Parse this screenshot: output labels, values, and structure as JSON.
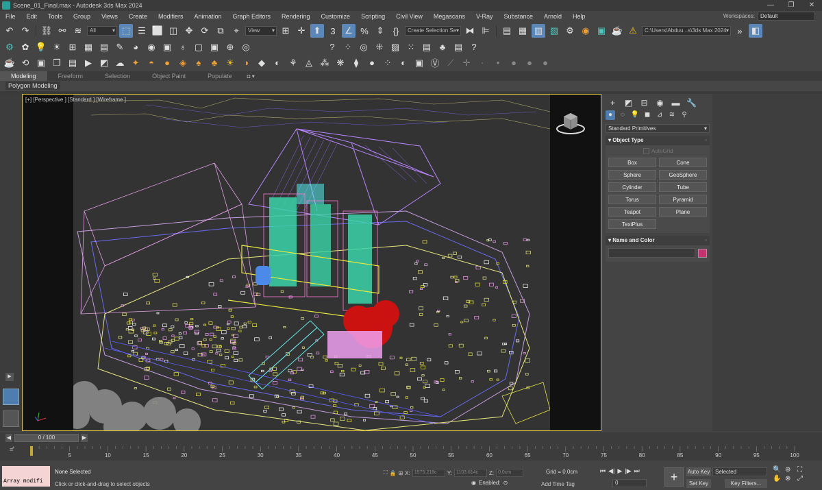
{
  "title": "Scene_01_Final.max - Autodesk 3ds Max 2024",
  "window_controls": [
    "—",
    "❐",
    "✕"
  ],
  "menu": [
    "File",
    "Edit",
    "Tools",
    "Group",
    "Views",
    "Create",
    "Modifiers",
    "Animation",
    "Graph Editors",
    "Rendering",
    "Customize",
    "Scripting",
    "Civil View",
    "Megascans",
    "V-Ray",
    "Substance",
    "Arnold",
    "Help"
  ],
  "workspaces": {
    "label": "Workspaces:",
    "value": "Default"
  },
  "toolbar": {
    "selection_filter": "All",
    "ref_coord": "View",
    "selection_set": "Create Selection Se",
    "project_path": "C:\\Users\\Abduu...s\\3ds Max 2024"
  },
  "ribbon": {
    "tabs": [
      "Modeling",
      "Freeform",
      "Selection",
      "Object Paint",
      "Populate"
    ],
    "active": "Modeling",
    "pin": "◘ ▾",
    "sub_label": "Polygon Modeling"
  },
  "viewport": {
    "label": "[+] [Perspective ] [Standard ] [Wireframe ]"
  },
  "command_panel": {
    "category": "Standard Primitives",
    "object_type_title": "Object Type",
    "autogrid": "AutoGrid",
    "objects": [
      "Box",
      "Cone",
      "Sphere",
      "GeoSphere",
      "Cylinder",
      "Tube",
      "Torus",
      "Pyramid",
      "Teapot",
      "Plane",
      "TextPlus"
    ],
    "name_color_title": "Name and Color",
    "object_color": "#c2336f"
  },
  "timeline": {
    "frame_display": "0 / 100",
    "ticks": [
      0,
      5,
      10,
      15,
      20,
      25,
      30,
      35,
      40,
      45,
      50,
      55,
      60,
      65,
      70,
      75,
      80,
      85,
      90,
      95,
      100
    ]
  },
  "status": {
    "listener_text": "Array modifi",
    "selection": "None Selected",
    "prompt": "Click or click-and-drag to select objects",
    "x_label": "X:",
    "x_value": "1575.218c",
    "y_label": "Y:",
    "y_value": "1103.614c",
    "z_label": "Z:",
    "z_value": "0.0cm",
    "grid": "Grid = 0.0cm",
    "enabled": "Enabled:",
    "add_time_tag": "Add Time Tag",
    "current_frame": "0",
    "auto_key": "Auto Key",
    "set_key": "Set Key",
    "key_mode": "Selected",
    "key_filters": "Key Filters..."
  }
}
